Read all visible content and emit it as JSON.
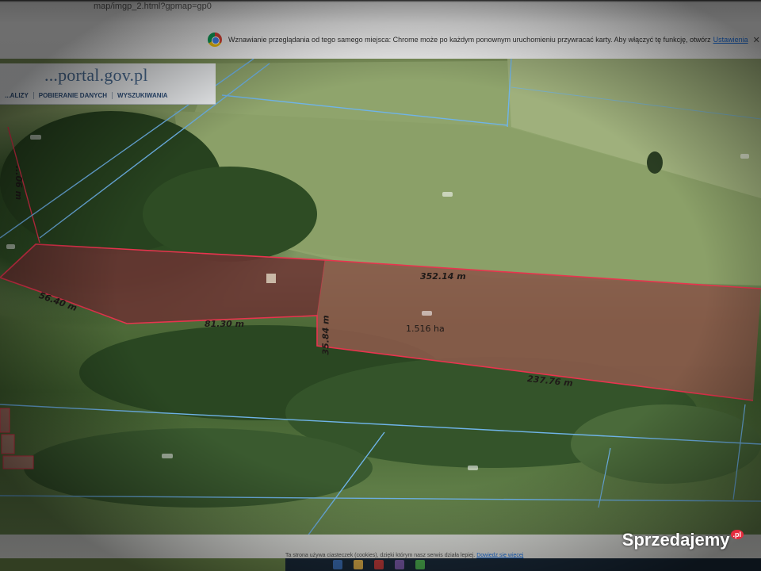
{
  "browser": {
    "url_fragment": "map/imgp_2.html?gpmap=gp0",
    "infobar": {
      "message": "Wznawianie przeglądania od tego samego miejsca: Chrome może po każdym ponownym uruchomieniu przywracać karty. Aby włączyć tę funkcję, otwórz",
      "link": "Ustawienia",
      "close": "✕"
    }
  },
  "geoportal": {
    "title": "...portal.gov.pl",
    "nav": [
      "...ALIZY",
      "POBIERANIE DANYCH",
      "WYSZUKIWANIA"
    ]
  },
  "map": {
    "measurements": {
      "top": "352.14 m",
      "left_diag": "56.40 m",
      "bottom_left": "81.30 m",
      "vertical": "35.84 m",
      "bottom_right": "237.76 m",
      "far_left": "...06 m",
      "area": "1.516 ha"
    }
  },
  "footer": {
    "cookie_text": "Ta strona używa ciasteczek (cookies), dzięki którym nasz serwis działa lepiej.",
    "cookie_link": "Dowiedz się więcej"
  },
  "watermark": {
    "text": "Sprzedajemy",
    "badge": ".pl"
  },
  "colors": {
    "parcel_outline": "#e8344e",
    "parcel_fill": "#8a3b3e",
    "boundary_lines": "#6fb4e8",
    "geo_title": "#4a6c93"
  }
}
